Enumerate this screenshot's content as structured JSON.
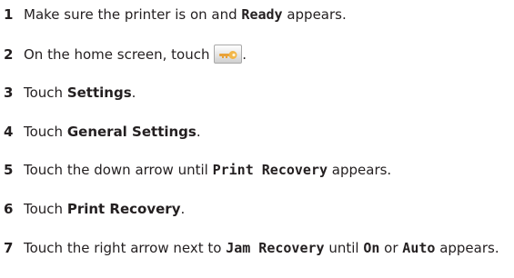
{
  "steps": [
    {
      "number": "1",
      "parts": [
        {
          "text": "Make sure the printer is on and ",
          "style": "normal"
        },
        {
          "text": "Ready",
          "style": "mono"
        },
        {
          "text": " appears.",
          "style": "normal"
        }
      ]
    },
    {
      "number": "2",
      "parts": [
        {
          "text": "On the home screen, touch ",
          "style": "normal"
        },
        {
          "icon": "wrench-key-icon"
        },
        {
          "text": ".",
          "style": "normal"
        }
      ]
    },
    {
      "number": "3",
      "parts": [
        {
          "text": "Touch ",
          "style": "normal"
        },
        {
          "text": "Settings",
          "style": "bold"
        },
        {
          "text": ".",
          "style": "normal"
        }
      ]
    },
    {
      "number": "4",
      "parts": [
        {
          "text": "Touch ",
          "style": "normal"
        },
        {
          "text": "General Settings",
          "style": "bold"
        },
        {
          "text": ".",
          "style": "normal"
        }
      ]
    },
    {
      "number": "5",
      "parts": [
        {
          "text": "Touch the down arrow until ",
          "style": "normal"
        },
        {
          "text": "Print Recovery",
          "style": "mono"
        },
        {
          "text": " appears.",
          "style": "normal"
        }
      ]
    },
    {
      "number": "6",
      "parts": [
        {
          "text": "Touch ",
          "style": "normal"
        },
        {
          "text": "Print Recovery",
          "style": "bold"
        },
        {
          "text": ".",
          "style": "normal"
        }
      ]
    },
    {
      "number": "7",
      "parts": [
        {
          "text": "Touch the right arrow next to ",
          "style": "normal"
        },
        {
          "text": "Jam Recovery",
          "style": "mono"
        },
        {
          "text": " until ",
          "style": "normal"
        },
        {
          "text": "On",
          "style": "mono"
        },
        {
          "text": " or ",
          "style": "normal"
        },
        {
          "text": "Auto",
          "style": "mono"
        },
        {
          "text": " appears.",
          "style": "normal"
        }
      ]
    }
  ],
  "colors": {
    "text": "#231f20",
    "icon_key": "#f0a830"
  }
}
